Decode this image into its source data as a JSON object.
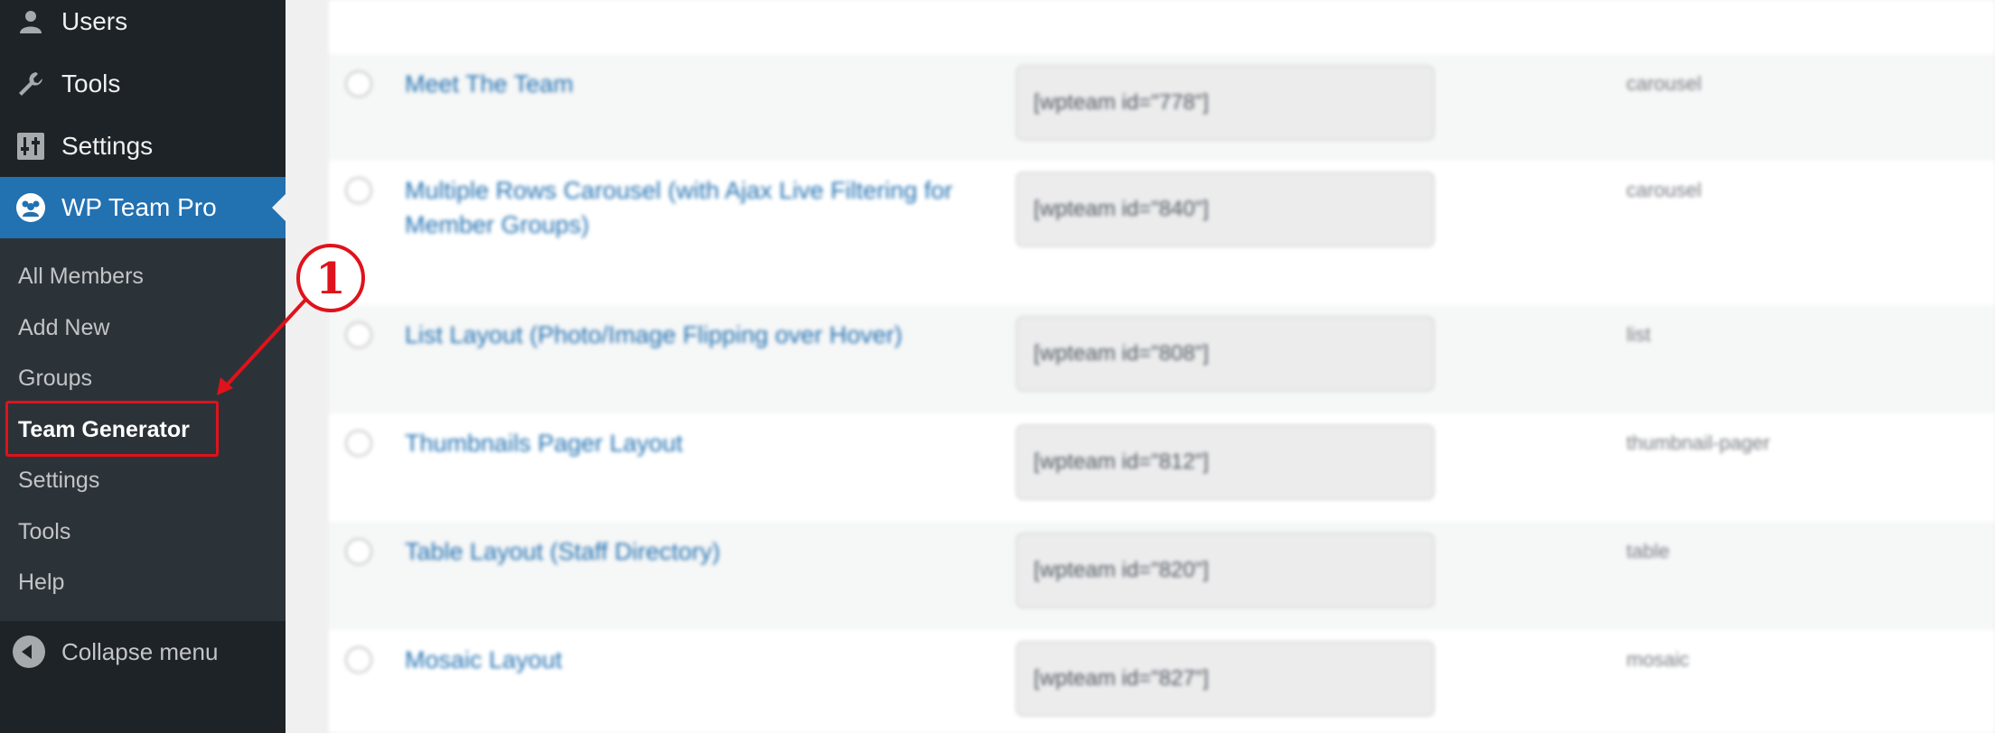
{
  "sidebar": {
    "top_items": [
      {
        "label": "Users",
        "icon": "user-icon"
      },
      {
        "label": "Tools",
        "icon": "wrench-icon"
      },
      {
        "label": "Settings",
        "icon": "settings-sliders-icon"
      },
      {
        "label": "WP Team Pro",
        "icon": "team-icon"
      }
    ],
    "submenu": [
      {
        "label": "All Members"
      },
      {
        "label": "Add New"
      },
      {
        "label": "Groups"
      },
      {
        "label": "Team Generator"
      },
      {
        "label": "Settings"
      },
      {
        "label": "Tools"
      },
      {
        "label": "Help"
      }
    ],
    "collapse_label": "Collapse menu"
  },
  "annotation": {
    "step": "1",
    "color": "#e0121b"
  },
  "colors": {
    "accent": "#2271b1",
    "sidebar_bg": "#1d2327",
    "submenu_bg": "#2c3338"
  },
  "table": {
    "rows": [
      {
        "title": "Meet The Team",
        "shortcode": "[wpteam id=\"778\"]",
        "layout": "carousel"
      },
      {
        "title": "Multiple Rows Carousel (with Ajax Live Filtering for Member Groups)",
        "shortcode": "[wpteam id=\"840\"]",
        "layout": "carousel"
      },
      {
        "title": "List Layout (Photo/Image Flipping over Hover)",
        "shortcode": "[wpteam id=\"808\"]",
        "layout": "list"
      },
      {
        "title": "Thumbnails Pager Layout",
        "shortcode": "[wpteam id=\"812\"]",
        "layout": "thumbnail-pager"
      },
      {
        "title": "Table Layout (Staff Directory)",
        "shortcode": "[wpteam id=\"820\"]",
        "layout": "table"
      },
      {
        "title": "Mosaic Layout",
        "shortcode": "[wpteam id=\"827\"]",
        "layout": "mosaic"
      }
    ]
  }
}
